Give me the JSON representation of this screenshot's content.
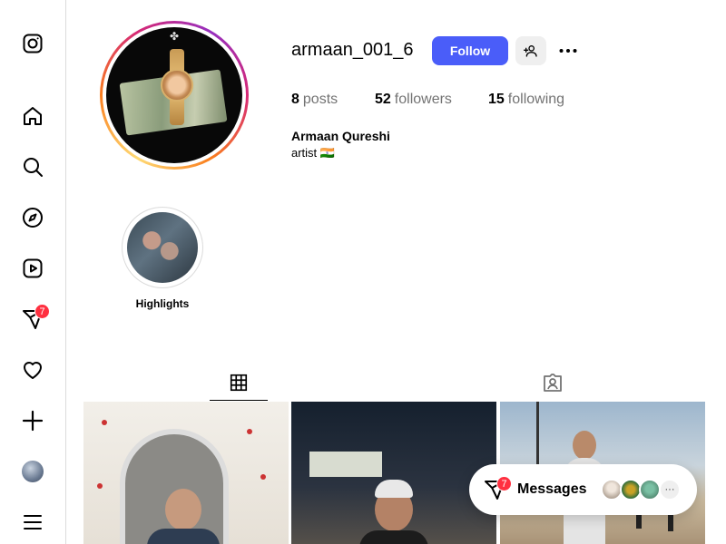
{
  "sidebar": {
    "items": [
      {
        "name": "instagram-logo-icon"
      },
      {
        "name": "home-icon"
      },
      {
        "name": "search-icon"
      },
      {
        "name": "explore-icon"
      },
      {
        "name": "reels-icon"
      },
      {
        "name": "messages-icon",
        "badge": "7"
      },
      {
        "name": "notifications-icon"
      },
      {
        "name": "create-icon"
      },
      {
        "name": "profile-avatar"
      },
      {
        "name": "more-menu-icon"
      }
    ]
  },
  "profile": {
    "username": "armaan_001_6",
    "follow_label": "Follow",
    "posts_count": "8",
    "posts_label": "posts",
    "followers_count": "52",
    "followers_label": "followers",
    "following_count": "15",
    "following_label": "following",
    "full_name": "Armaan Qureshi",
    "bio": "artist 🇮🇳"
  },
  "highlights": [
    {
      "label": "Highlights"
    }
  ],
  "tabs": [
    {
      "name": "posts-grid-icon",
      "active": true
    },
    {
      "name": "tagged-icon",
      "active": false
    }
  ],
  "messages": {
    "label": "Messages",
    "badge": "7",
    "more": "···"
  },
  "colors": {
    "accent": "#4a5df9",
    "badge": "#ff3040",
    "border": "#dbdbdb",
    "muted": "#737373"
  }
}
